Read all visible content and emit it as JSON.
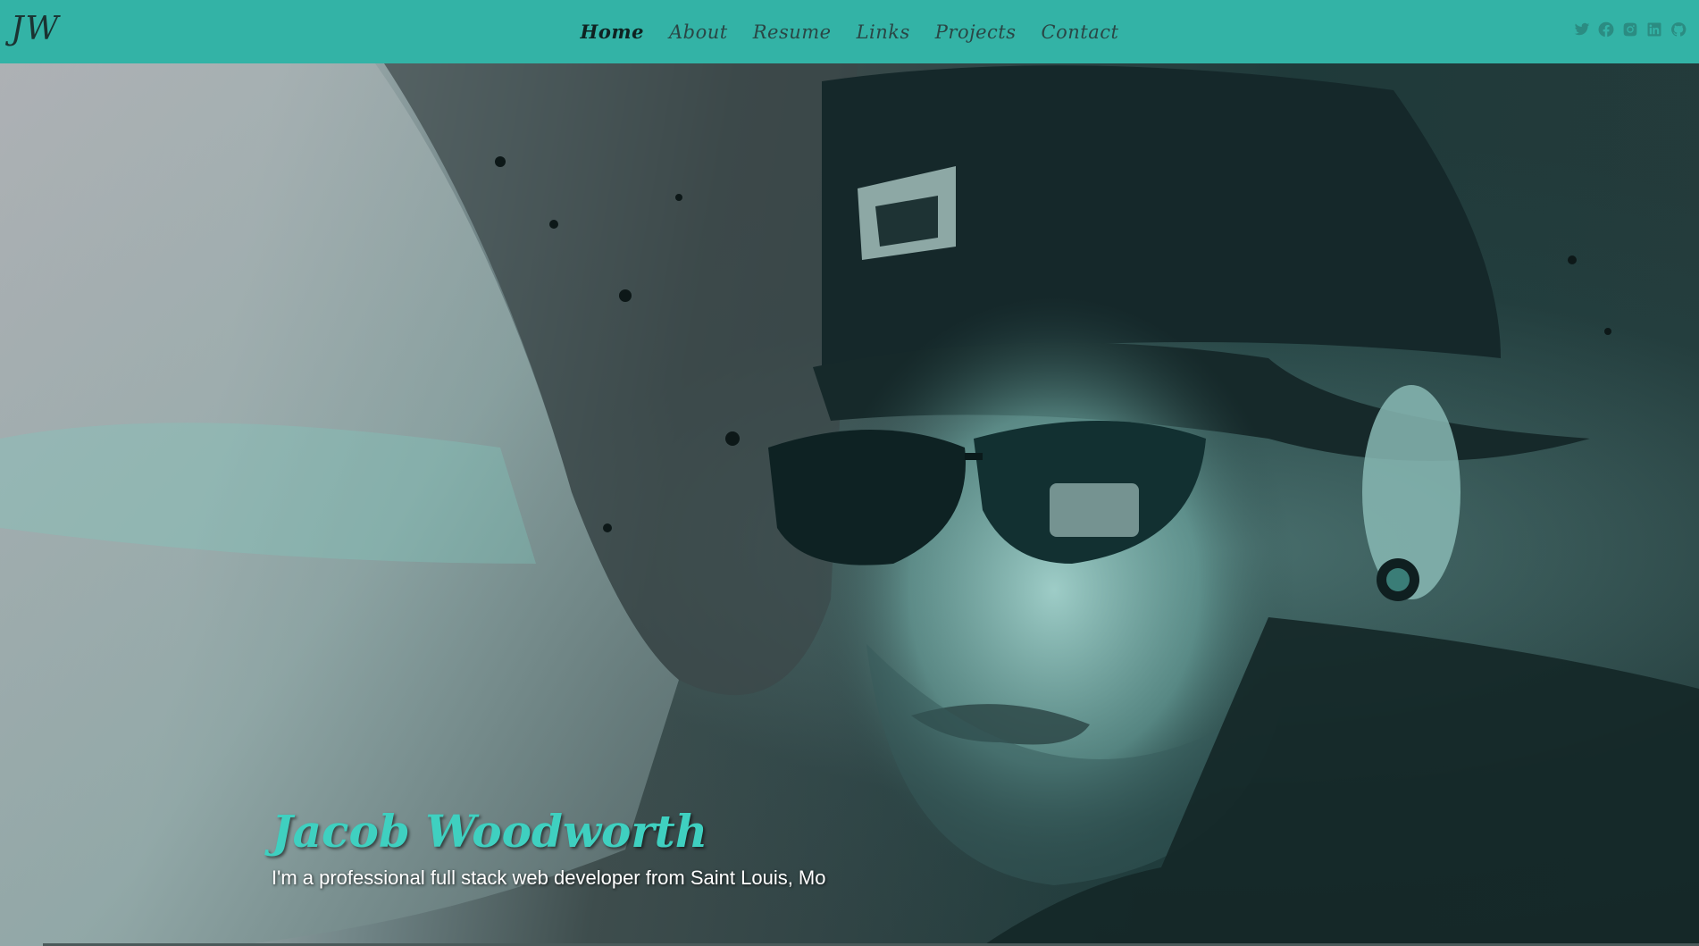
{
  "brand": {
    "logo": "JW"
  },
  "nav": {
    "items": [
      {
        "label": "Home",
        "active": true
      },
      {
        "label": "About"
      },
      {
        "label": "Resume"
      },
      {
        "label": "Links"
      },
      {
        "label": "Projects"
      },
      {
        "label": "Contact"
      }
    ]
  },
  "social": {
    "icons": [
      "twitter-icon",
      "facebook-icon",
      "instagram-icon",
      "linkedin-icon",
      "github-icon"
    ],
    "color": "#2b8c82"
  },
  "hero": {
    "name": "Jacob Woodworth",
    "subtitle": "I'm a professional full stack web developer from Saint Louis, Mo"
  },
  "colors": {
    "navbar": "#33b3a6",
    "accent": "#3fd0c0"
  }
}
